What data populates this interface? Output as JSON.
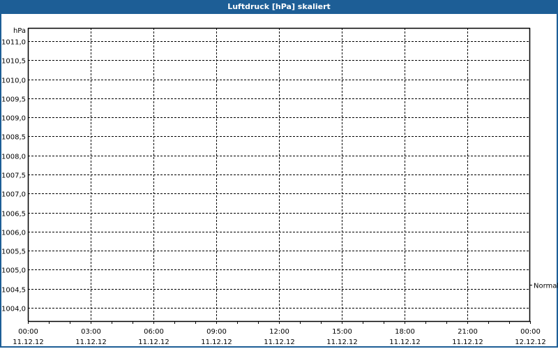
{
  "window": {
    "title": "Luftdruck [hPa] skaliert"
  },
  "chart_data": {
    "type": "line",
    "title": "Luftdruck [hPa] skaliert",
    "ylabel": "hPa",
    "xlabel": "",
    "ylim": [
      1003.65,
      1011.35
    ],
    "yticks": [
      1011.0,
      1010.5,
      1010.0,
      1009.5,
      1009.0,
      1008.5,
      1008.0,
      1007.5,
      1007.0,
      1006.5,
      1006.0,
      1005.5,
      1005.0,
      1004.5,
      1004.0
    ],
    "ytick_labels": [
      "1011,0",
      "1010,5",
      "1010,0",
      "1009,5",
      "1009,0",
      "1008,5",
      "1008,0",
      "1007,5",
      "1007,0",
      "1006,5",
      "1006,0",
      "1005,5",
      "1005,0",
      "1004,5",
      "1004,0"
    ],
    "xlim_hours": [
      0,
      24
    ],
    "xticks_hours": [
      0,
      3,
      6,
      9,
      12,
      15,
      18,
      21,
      24
    ],
    "xtick_times": [
      "00:00",
      "03:00",
      "06:00",
      "09:00",
      "12:00",
      "15:00",
      "18:00",
      "21:00",
      "00:00"
    ],
    "xtick_dates": [
      "11.12.12",
      "11.12.12",
      "11.12.12",
      "11.12.12",
      "11.12.12",
      "11.12.12",
      "11.12.12",
      "11.12.12",
      "12.12.12"
    ],
    "minor_tick_interval_hours": 1,
    "grid": true,
    "reference_markers": [
      {
        "label": "Normal",
        "value": 1004.6
      }
    ],
    "series": []
  }
}
